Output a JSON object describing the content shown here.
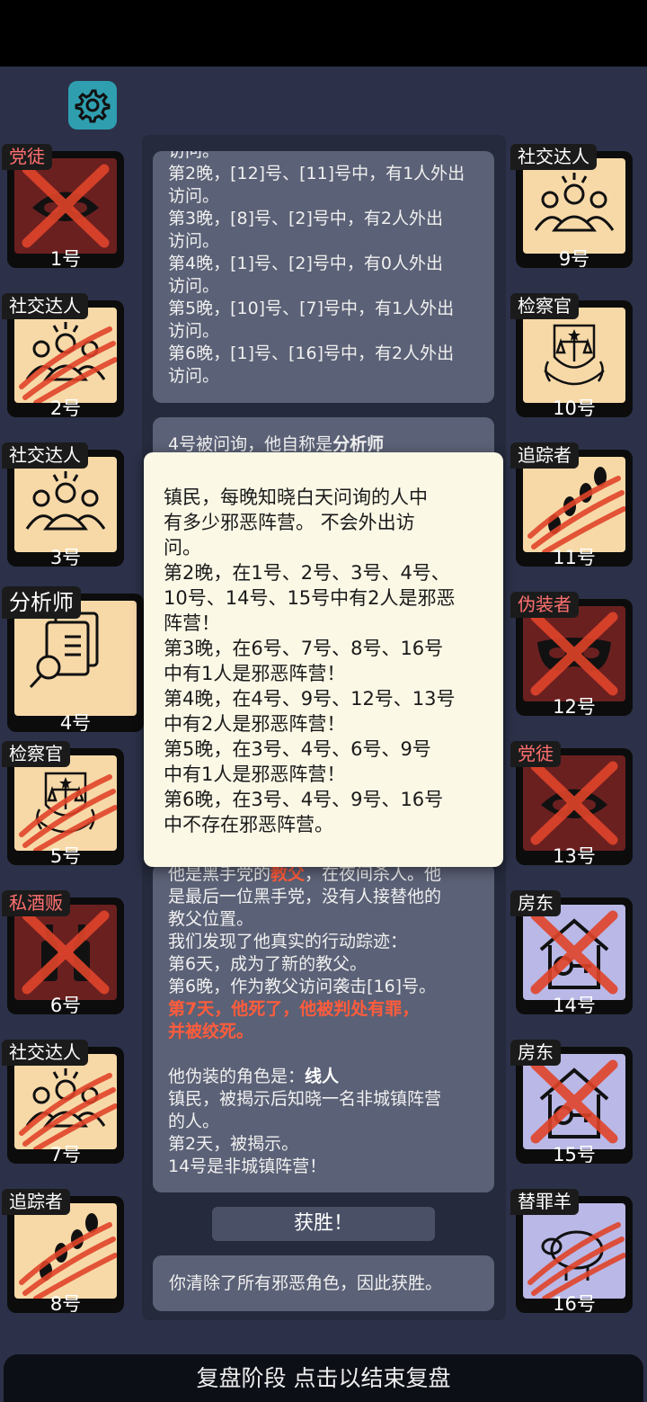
{
  "settings": {
    "icon": "gear-icon"
  },
  "left_column": [
    {
      "role": "党徒",
      "num": "1号",
      "theme": "evil",
      "icon": "eyes-mask-icon",
      "state": "x"
    },
    {
      "role": "社交达人",
      "num": "2号",
      "theme": "pale",
      "icon": "people-group-icon",
      "state": "claw"
    },
    {
      "role": "社交达人",
      "num": "3号",
      "theme": "pale",
      "icon": "people-group-icon",
      "state": "none"
    },
    {
      "role": "分析师",
      "num": "4号",
      "theme": "pale",
      "icon": "documents-magnifier-icon",
      "state": "none",
      "big": true
    },
    {
      "role": "检察官",
      "num": "5号",
      "theme": "pale",
      "icon": "scales-emblem-icon",
      "state": "claw"
    },
    {
      "role": "私酒贩",
      "num": "6号",
      "theme": "evil",
      "icon": "bottles-icon",
      "state": "x"
    },
    {
      "role": "社交达人",
      "num": "7号",
      "theme": "pale",
      "icon": "people-group-icon",
      "state": "claw"
    },
    {
      "role": "追踪者",
      "num": "8号",
      "theme": "pale",
      "icon": "footprints-icon",
      "state": "claw"
    }
  ],
  "right_column": [
    {
      "role": "社交达人",
      "num": "9号",
      "theme": "pale",
      "icon": "people-group-icon",
      "state": "none"
    },
    {
      "role": "检察官",
      "num": "10号",
      "theme": "pale",
      "icon": "scales-emblem-icon",
      "state": "none"
    },
    {
      "role": "追踪者",
      "num": "11号",
      "theme": "pale",
      "icon": "footprints-icon",
      "state": "claw"
    },
    {
      "role": "伪装者",
      "num": "12号",
      "theme": "evil",
      "icon": "mask-icon",
      "state": "x"
    },
    {
      "role": "党徒",
      "num": "13号",
      "theme": "evil",
      "icon": "eyes-mask-icon",
      "state": "x"
    },
    {
      "role": "房东",
      "num": "14号",
      "theme": "purple",
      "icon": "house-key-icon",
      "state": "x"
    },
    {
      "role": "房东",
      "num": "15号",
      "theme": "purple",
      "icon": "house-key-icon",
      "state": "x"
    },
    {
      "role": "替罪羊",
      "num": "16号",
      "theme": "purple",
      "icon": "sheep-icon",
      "state": "claw"
    }
  ],
  "log_top": {
    "lines": [
      "访问。",
      "第2晚，[12]号、[11]号中，有1人外出",
      "访问。",
      "第3晚，[8]号、[2]号中，有2人外出",
      "访问。",
      "第4晚，[1]号、[2]号中，有0人外出",
      "访问。",
      "第5晚，[10]号、[7]号中，有1人外出",
      "访问。",
      "第6晚，[1]号、[16]号中，有2人外出",
      "访问。"
    ]
  },
  "log_mid": {
    "prefix": "4号被问询，他自称是",
    "role": "分析师"
  },
  "log_bottom": {
    "line1_a": "他是黑手党的",
    "line1_role": "教父",
    "line1_b": "，在夜间杀人。他",
    "lines": [
      "是最后一位黑手党，没有人接替他的",
      "教父位置。",
      "我们发现了他真实的行动踪迹：",
      "第6天，成为了新的教父。",
      "第6晚，作为教父访问袭击[16]号。"
    ],
    "verdict1": "第7天，他死了，他被判处有罪，",
    "verdict2": "并被绞死。",
    "disguise_label": "他伪装的角色是：",
    "disguise_role": "线人",
    "lines2": [
      "镇民，被揭示后知晓一名非城镇阵营",
      "的人。",
      "第2天，被揭示。",
      "14号是非城镇阵营！"
    ]
  },
  "win_button": "获胜！",
  "win_message": "你清除了所有邪恶角色，因此获胜。",
  "popup": {
    "lines": [
      "镇民，每晚知晓白天问询的人中",
      "有多少邪恶阵营。 不会外出访",
      "问。",
      "第2晚，在1号、2号、3号、4号、",
      "10号、14号、15号中有2人是邪恶",
      "阵营！",
      "第3晚，在6号、7号、8号、16号",
      "中有1人是邪恶阵营！",
      "第4晚，在4号、9号、12号、13号",
      "中有2人是邪恶阵营！",
      "第5晚，在3号、4号、6号、9号",
      "中有1人是邪恶阵营！",
      "第6晚，在3号、4号、9号、16号",
      "中不存在邪恶阵营。"
    ]
  },
  "footer": "复盘阶段 点击以结束复盘",
  "colors": {
    "evil_red": "#6b2020",
    "pale": "#f7d9a8",
    "purple": "#b9b8e6",
    "accent_red": "#ff5c3c",
    "claw": "#e0442a"
  }
}
